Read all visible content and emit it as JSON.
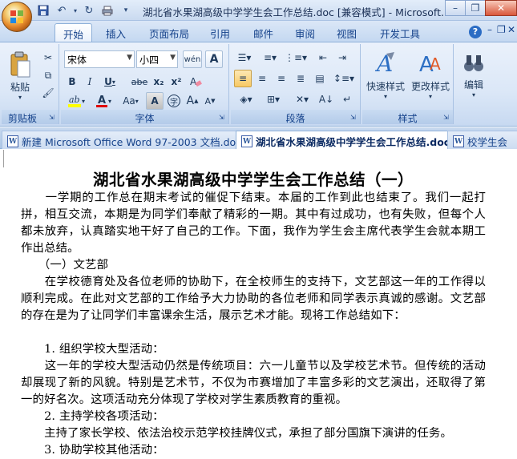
{
  "window": {
    "title": "湖北省水果湖高级中学学生会工作总结.doc [兼容模式] - Microsoft...",
    "qat_buttons": [
      "save-icon",
      "undo-icon",
      "redo-icon",
      "repeat-icon",
      "customize-icon"
    ]
  },
  "tabs": [
    "开始",
    "插入",
    "页面布局",
    "引用",
    "邮件",
    "审阅",
    "视图",
    "开发工具"
  ],
  "ribbon": {
    "clipboard": {
      "label": "剪贴板",
      "paste": "粘贴"
    },
    "font": {
      "label": "字体",
      "name": "宋体",
      "size": "小四",
      "bold": "B",
      "italic": "I",
      "underline": "U",
      "strike": "abe",
      "sub": "x₂",
      "sup": "x²",
      "aa": "Aa",
      "grow": "A",
      "shrink": "A",
      "wen": "wén",
      "clear": "A",
      "char_border": "A",
      "enc": "字"
    },
    "paragraph": {
      "label": "段落"
    },
    "styles": {
      "label": "样式",
      "quick": "快速样式",
      "change": "更改样式"
    },
    "editing": {
      "label": "编辑"
    }
  },
  "doc_tabs": [
    {
      "label": "新建 Microsoft Office Word 97-2003 文档.doc",
      "active": false
    },
    {
      "label": "湖北省水果湖高级中学学生会工作总结.doc",
      "active": true
    },
    {
      "label": "校学生会",
      "active": false
    }
  ],
  "document": {
    "title": "湖北省水果湖高级中学学生会工作总结（一）",
    "paragraphs": [
      "　　一学期的工作总在期末考试的催促下结束。本届的工作到此也结束了。我们一起打拼，相互交流，本期是为同学们奉献了精彩的一期。其中有过成功，也有失败，但每个人都未放弃，认真踏实地干好了自己的工作。下面，我作为学生会主席代表学生会就本期工作出总结。",
      "　　（一）文艺部",
      "　　在学校德育处及各位老师的协助下，在全校师生的支持下，文艺部这一年的工作得以顺利完成。在此对文艺部的工作给予大力协助的各位老师和同学表示真诚的感谢。文艺部的存在是为了让同学们丰富课余生活，展示艺术才能。现将工作总结如下：",
      "　　1. 组织学校大型活动：",
      "　　这一年的学校大型活动仍然是传统项目：六一儿童节以及学校艺术节。但传统的活动却展现了新的风貌。特别是艺术节，不仅为市赛增加了丰富多彩的文艺演出，还取得了第一的好名次。这项活动充分体现了学校对学生素质教育的重视。",
      "　　2. 主持学校各项活动：",
      "　　主持了家长学校、依法治校示范学校挂牌仪式，承担了部分国旗下演讲的任务。",
      "　　3. 协助学校其他活动："
    ]
  }
}
